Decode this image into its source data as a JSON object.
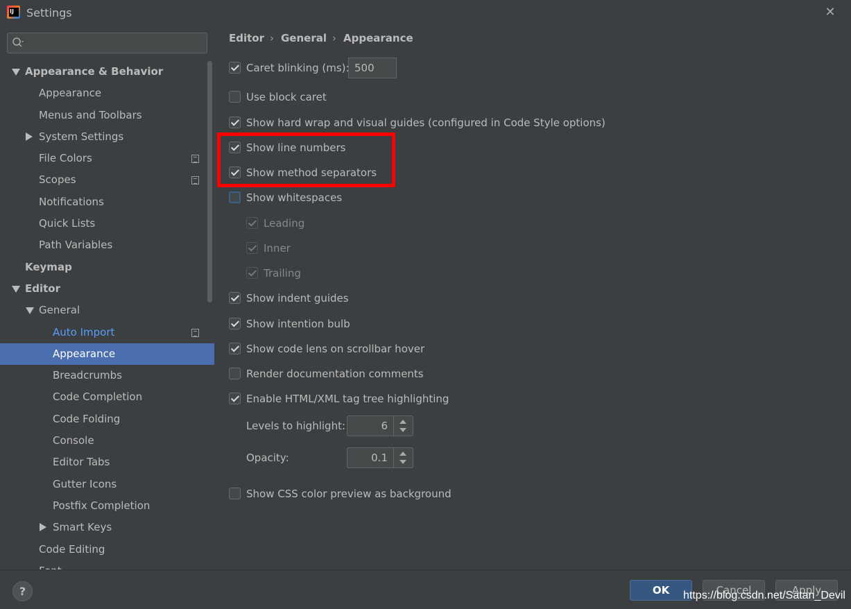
{
  "window": {
    "title": "Settings"
  },
  "search": {
    "placeholder": ""
  },
  "tree": [
    {
      "label": "Appearance & Behavior",
      "level": 0,
      "arrow": "down",
      "bold": true
    },
    {
      "label": "Appearance",
      "level": 1
    },
    {
      "label": "Menus and Toolbars",
      "level": 1
    },
    {
      "label": "System Settings",
      "level": 1,
      "arrow": "right"
    },
    {
      "label": "File Colors",
      "level": 1,
      "copy": true
    },
    {
      "label": "Scopes",
      "level": 1,
      "copy": true
    },
    {
      "label": "Notifications",
      "level": 1
    },
    {
      "label": "Quick Lists",
      "level": 1
    },
    {
      "label": "Path Variables",
      "level": 1
    },
    {
      "label": "Keymap",
      "level": 0,
      "bold": true
    },
    {
      "label": "Editor",
      "level": 0,
      "arrow": "down",
      "bold": true
    },
    {
      "label": "General",
      "level": 1,
      "arrow": "down"
    },
    {
      "label": "Auto Import",
      "level": 2,
      "link": true,
      "copy": true
    },
    {
      "label": "Appearance",
      "level": 2,
      "selected": true
    },
    {
      "label": "Breadcrumbs",
      "level": 2
    },
    {
      "label": "Code Completion",
      "level": 2
    },
    {
      "label": "Code Folding",
      "level": 2
    },
    {
      "label": "Console",
      "level": 2
    },
    {
      "label": "Editor Tabs",
      "level": 2
    },
    {
      "label": "Gutter Icons",
      "level": 2
    },
    {
      "label": "Postfix Completion",
      "level": 2
    },
    {
      "label": "Smart Keys",
      "level": 2,
      "arrow": "right"
    },
    {
      "label": "Code Editing",
      "level": 1
    },
    {
      "label": "Font",
      "level": 1
    }
  ],
  "breadcrumb": [
    "Editor",
    "General",
    "Appearance"
  ],
  "options": {
    "caret_blinking": {
      "label": "Caret blinking (ms):",
      "checked": true,
      "value": "500"
    },
    "block_caret": {
      "label": "Use block caret",
      "checked": false
    },
    "hard_wrap": {
      "label": "Show hard wrap and visual guides (configured in Code Style options)",
      "checked": true
    },
    "line_numbers": {
      "label": "Show line numbers",
      "checked": true
    },
    "method_separators": {
      "label": "Show method separators",
      "checked": true
    },
    "whitespaces": {
      "label": "Show whitespaces",
      "checked": false
    },
    "leading": {
      "label": "Leading",
      "checked": true
    },
    "inner": {
      "label": "Inner",
      "checked": true
    },
    "trailing": {
      "label": "Trailing",
      "checked": true
    },
    "indent_guides": {
      "label": "Show indent guides",
      "checked": true
    },
    "intention_bulb": {
      "label": "Show intention bulb",
      "checked": true
    },
    "code_lens": {
      "label": "Show code lens on scrollbar hover",
      "checked": true
    },
    "render_docs": {
      "label": "Render documentation comments",
      "checked": false
    },
    "tag_tree": {
      "label": "Enable HTML/XML tag tree highlighting",
      "checked": true
    },
    "levels": {
      "label": "Levels to highlight:",
      "value": "6"
    },
    "opacity": {
      "label": "Opacity:",
      "value": "0.1"
    },
    "css_preview": {
      "label": "Show CSS color preview as background",
      "checked": false
    }
  },
  "buttons": {
    "help": "?",
    "ok": "OK",
    "cancel": "Cancel",
    "apply": "Apply"
  },
  "watermark": "https://blog.csdn.net/Satan_Devil",
  "colors": {
    "background": "#3c3f41",
    "selection": "#4b6eaf",
    "link": "#589df6",
    "highlight": "#ff0000"
  }
}
